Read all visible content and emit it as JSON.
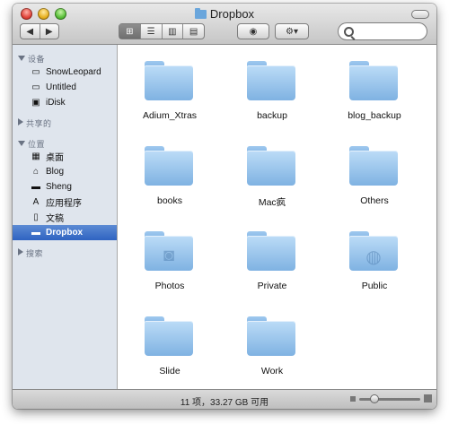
{
  "window": {
    "title": "Dropbox"
  },
  "sidebar": {
    "groups": [
      {
        "label": "设备"
      },
      {
        "label": "共享的"
      },
      {
        "label": "位置"
      },
      {
        "label": "搜索"
      }
    ],
    "devices": [
      {
        "label": "SnowLeopard",
        "icon": "hard-drive-icon"
      },
      {
        "label": "Untitled",
        "icon": "hard-drive-icon"
      },
      {
        "label": "iDisk",
        "icon": "idisk-icon"
      }
    ],
    "places": [
      {
        "label": "桌面",
        "icon": "desktop-icon"
      },
      {
        "label": "Blog",
        "icon": "home-icon"
      },
      {
        "label": "Sheng",
        "icon": "folder-icon"
      },
      {
        "label": "应用程序",
        "icon": "applications-icon"
      },
      {
        "label": "文稿",
        "icon": "documents-icon"
      },
      {
        "label": "Dropbox",
        "icon": "dropbox-folder-icon",
        "selected": true
      }
    ]
  },
  "content": {
    "items": [
      {
        "label": "Adium_Xtras",
        "icon": "folder-icon"
      },
      {
        "label": "backup",
        "icon": "folder-icon"
      },
      {
        "label": "blog_backup",
        "icon": "folder-icon"
      },
      {
        "label": "books",
        "icon": "folder-icon"
      },
      {
        "label": "Mac疯",
        "icon": "folder-icon"
      },
      {
        "label": "Others",
        "icon": "folder-icon"
      },
      {
        "label": "Photos",
        "icon": "pictures-folder-icon"
      },
      {
        "label": "Private",
        "icon": "folder-icon"
      },
      {
        "label": "Public",
        "icon": "public-folder-icon"
      },
      {
        "label": "Slide",
        "icon": "folder-icon"
      },
      {
        "label": "Work",
        "icon": "folder-icon"
      }
    ]
  },
  "status": {
    "text": "11 项，33.27 GB 可用"
  },
  "colors": {
    "sidebar_bg": "#dfe5ed",
    "selection": "#2f63c1",
    "folder_blue": "#86b8e6"
  }
}
